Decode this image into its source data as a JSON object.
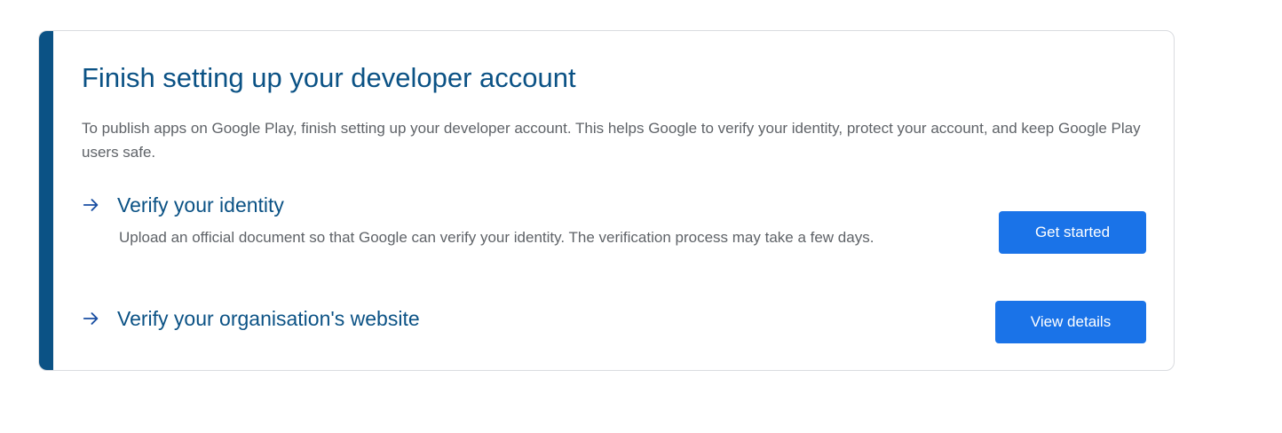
{
  "colors": {
    "accent_bar": "#0b5285",
    "heading": "#0b5285",
    "body_text": "#5f6368",
    "arrow": "#1a4fa3",
    "button_bg": "#1a73e8",
    "border": "#dadce0"
  },
  "card": {
    "title": "Finish setting up your developer account",
    "intro": "To publish apps on Google Play, finish setting up your developer account. This helps Google to verify your identity, protect your account, and keep Google Play users safe.",
    "tasks": [
      {
        "icon": "arrow-right-icon",
        "title": "Verify your identity",
        "description": "Upload an official document so that Google can verify your identity. The verification process may take a few days.",
        "button_label": "Get started"
      },
      {
        "icon": "arrow-right-icon",
        "title": "Verify your organisation's website",
        "description": "",
        "button_label": "View details"
      }
    ]
  }
}
